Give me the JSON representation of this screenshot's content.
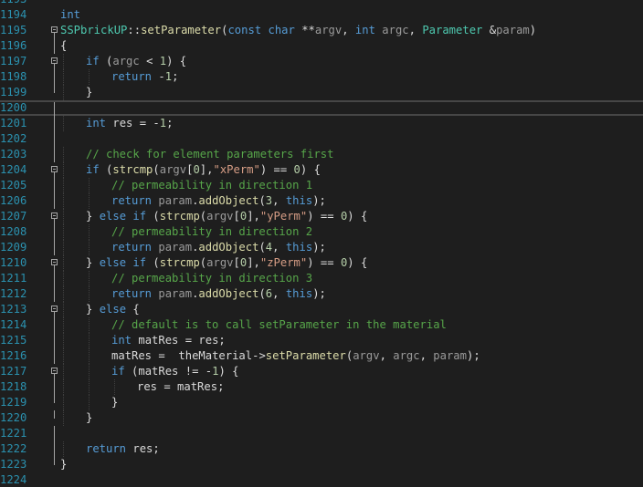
{
  "editor": {
    "lines": [
      {
        "n": "1194",
        "fold": "",
        "indent": 0,
        "tokens": [
          {
            "t": "int",
            "c": "kw"
          }
        ]
      },
      {
        "n": "1195",
        "fold": "start",
        "indent": 0,
        "tokens": [
          {
            "t": "SSPbrickUP",
            "c": "ty"
          },
          {
            "t": "::",
            "c": "pl"
          },
          {
            "t": "setParameter",
            "c": "fn"
          },
          {
            "t": "(",
            "c": "pl"
          },
          {
            "t": "const",
            "c": "kw"
          },
          {
            "t": " ",
            "c": "pl"
          },
          {
            "t": "char",
            "c": "kw"
          },
          {
            "t": " **",
            "c": "pl"
          },
          {
            "t": "argv",
            "c": "par"
          },
          {
            "t": ", ",
            "c": "pl"
          },
          {
            "t": "int",
            "c": "kw"
          },
          {
            "t": " ",
            "c": "pl"
          },
          {
            "t": "argc",
            "c": "par"
          },
          {
            "t": ", ",
            "c": "pl"
          },
          {
            "t": "Parameter",
            "c": "ty"
          },
          {
            "t": " &",
            "c": "pl"
          },
          {
            "t": "param",
            "c": "par"
          },
          {
            "t": ")",
            "c": "pl"
          }
        ]
      },
      {
        "n": "1196",
        "fold": "mid",
        "indent": 0,
        "tokens": [
          {
            "t": "{",
            "c": "pl"
          }
        ]
      },
      {
        "n": "1197",
        "fold": "start",
        "indent": 1,
        "tokens": [
          {
            "t": "if",
            "c": "kw"
          },
          {
            "t": " (",
            "c": "pl"
          },
          {
            "t": "argc",
            "c": "par"
          },
          {
            "t": " < ",
            "c": "pl"
          },
          {
            "t": "1",
            "c": "num"
          },
          {
            "t": ") {",
            "c": "pl"
          }
        ]
      },
      {
        "n": "1198",
        "fold": "mid",
        "indent": 2,
        "tokens": [
          {
            "t": "return",
            "c": "kw"
          },
          {
            "t": " -",
            "c": "pl"
          },
          {
            "t": "1",
            "c": "num"
          },
          {
            "t": ";",
            "c": "pl"
          }
        ]
      },
      {
        "n": "1199",
        "fold": "end",
        "indent": 1,
        "tokens": [
          {
            "t": "}",
            "c": "pl"
          }
        ]
      },
      {
        "n": "1200",
        "fold": "mid",
        "indent": 0,
        "current": true,
        "tokens": []
      },
      {
        "n": "1201",
        "fold": "mid",
        "indent": 1,
        "tokens": [
          {
            "t": "int",
            "c": "kw"
          },
          {
            "t": " ",
            "c": "pl"
          },
          {
            "t": "res",
            "c": "var"
          },
          {
            "t": " = -",
            "c": "pl"
          },
          {
            "t": "1",
            "c": "num"
          },
          {
            "t": ";",
            "c": "pl"
          }
        ]
      },
      {
        "n": "1202",
        "fold": "mid",
        "indent": 0,
        "tokens": []
      },
      {
        "n": "1203",
        "fold": "mid",
        "indent": 1,
        "tokens": [
          {
            "t": "// check for element parameters first",
            "c": "cm"
          }
        ]
      },
      {
        "n": "1204",
        "fold": "start",
        "indent": 1,
        "tokens": [
          {
            "t": "if",
            "c": "kw"
          },
          {
            "t": " (",
            "c": "pl"
          },
          {
            "t": "strcmp",
            "c": "fn"
          },
          {
            "t": "(",
            "c": "pl"
          },
          {
            "t": "argv",
            "c": "par"
          },
          {
            "t": "[",
            "c": "pl"
          },
          {
            "t": "0",
            "c": "num"
          },
          {
            "t": "],",
            "c": "pl"
          },
          {
            "t": "\"xPerm\"",
            "c": "str"
          },
          {
            "t": ") == ",
            "c": "pl"
          },
          {
            "t": "0",
            "c": "num"
          },
          {
            "t": ") {",
            "c": "pl"
          }
        ]
      },
      {
        "n": "1205",
        "fold": "mid",
        "indent": 2,
        "tokens": [
          {
            "t": "// permeability in direction 1",
            "c": "cm"
          }
        ]
      },
      {
        "n": "1206",
        "fold": "mid",
        "indent": 2,
        "tokens": [
          {
            "t": "return",
            "c": "kw"
          },
          {
            "t": " ",
            "c": "pl"
          },
          {
            "t": "param",
            "c": "par"
          },
          {
            "t": ".",
            "c": "pl"
          },
          {
            "t": "addObject",
            "c": "fn"
          },
          {
            "t": "(",
            "c": "pl"
          },
          {
            "t": "3",
            "c": "num"
          },
          {
            "t": ", ",
            "c": "pl"
          },
          {
            "t": "this",
            "c": "kw"
          },
          {
            "t": ");",
            "c": "pl"
          }
        ]
      },
      {
        "n": "1207",
        "fold": "start",
        "indent": 1,
        "tokens": [
          {
            "t": "} ",
            "c": "pl"
          },
          {
            "t": "else",
            "c": "kw"
          },
          {
            "t": " ",
            "c": "pl"
          },
          {
            "t": "if",
            "c": "kw"
          },
          {
            "t": " (",
            "c": "pl"
          },
          {
            "t": "strcmp",
            "c": "fn"
          },
          {
            "t": "(",
            "c": "pl"
          },
          {
            "t": "argv",
            "c": "par"
          },
          {
            "t": "[",
            "c": "pl"
          },
          {
            "t": "0",
            "c": "num"
          },
          {
            "t": "],",
            "c": "pl"
          },
          {
            "t": "\"yPerm\"",
            "c": "str"
          },
          {
            "t": ") == ",
            "c": "pl"
          },
          {
            "t": "0",
            "c": "num"
          },
          {
            "t": ") {",
            "c": "pl"
          }
        ]
      },
      {
        "n": "1208",
        "fold": "mid",
        "indent": 2,
        "tokens": [
          {
            "t": "// permeability in direction 2",
            "c": "cm"
          }
        ]
      },
      {
        "n": "1209",
        "fold": "mid",
        "indent": 2,
        "tokens": [
          {
            "t": "return",
            "c": "kw"
          },
          {
            "t": " ",
            "c": "pl"
          },
          {
            "t": "param",
            "c": "par"
          },
          {
            "t": ".",
            "c": "pl"
          },
          {
            "t": "addObject",
            "c": "fn"
          },
          {
            "t": "(",
            "c": "pl"
          },
          {
            "t": "4",
            "c": "num"
          },
          {
            "t": ", ",
            "c": "pl"
          },
          {
            "t": "this",
            "c": "kw"
          },
          {
            "t": ");",
            "c": "pl"
          }
        ]
      },
      {
        "n": "1210",
        "fold": "start",
        "indent": 1,
        "tokens": [
          {
            "t": "} ",
            "c": "pl"
          },
          {
            "t": "else",
            "c": "kw"
          },
          {
            "t": " ",
            "c": "pl"
          },
          {
            "t": "if",
            "c": "kw"
          },
          {
            "t": " (",
            "c": "pl"
          },
          {
            "t": "strcmp",
            "c": "fn"
          },
          {
            "t": "(",
            "c": "pl"
          },
          {
            "t": "argv",
            "c": "par"
          },
          {
            "t": "[",
            "c": "pl"
          },
          {
            "t": "0",
            "c": "num"
          },
          {
            "t": "],",
            "c": "pl"
          },
          {
            "t": "\"zPerm\"",
            "c": "str"
          },
          {
            "t": ") == ",
            "c": "pl"
          },
          {
            "t": "0",
            "c": "num"
          },
          {
            "t": ") {",
            "c": "pl"
          }
        ]
      },
      {
        "n": "1211",
        "fold": "mid",
        "indent": 2,
        "tokens": [
          {
            "t": "// permeability in direction 3",
            "c": "cm"
          }
        ]
      },
      {
        "n": "1212",
        "fold": "mid",
        "indent": 2,
        "tokens": [
          {
            "t": "return",
            "c": "kw"
          },
          {
            "t": " ",
            "c": "pl"
          },
          {
            "t": "param",
            "c": "par"
          },
          {
            "t": ".",
            "c": "pl"
          },
          {
            "t": "addObject",
            "c": "fn"
          },
          {
            "t": "(",
            "c": "pl"
          },
          {
            "t": "6",
            "c": "num"
          },
          {
            "t": ", ",
            "c": "pl"
          },
          {
            "t": "this",
            "c": "kw"
          },
          {
            "t": ");",
            "c": "pl"
          }
        ]
      },
      {
        "n": "1213",
        "fold": "start",
        "indent": 1,
        "tokens": [
          {
            "t": "} ",
            "c": "pl"
          },
          {
            "t": "else",
            "c": "kw"
          },
          {
            "t": " {",
            "c": "pl"
          }
        ]
      },
      {
        "n": "1214",
        "fold": "mid",
        "indent": 2,
        "tokens": [
          {
            "t": "// default is to call setParameter in the material",
            "c": "cm"
          }
        ]
      },
      {
        "n": "1215",
        "fold": "mid",
        "indent": 2,
        "tokens": [
          {
            "t": "int",
            "c": "kw"
          },
          {
            "t": " ",
            "c": "pl"
          },
          {
            "t": "matRes",
            "c": "var"
          },
          {
            "t": " = ",
            "c": "pl"
          },
          {
            "t": "res",
            "c": "var"
          },
          {
            "t": ";",
            "c": "pl"
          }
        ]
      },
      {
        "n": "1216",
        "fold": "mid",
        "indent": 2,
        "tokens": [
          {
            "t": "matRes",
            "c": "var"
          },
          {
            "t": " =  ",
            "c": "pl"
          },
          {
            "t": "theMaterial",
            "c": "var"
          },
          {
            "t": "->",
            "c": "pl"
          },
          {
            "t": "setParameter",
            "c": "fn"
          },
          {
            "t": "(",
            "c": "pl"
          },
          {
            "t": "argv",
            "c": "par"
          },
          {
            "t": ", ",
            "c": "pl"
          },
          {
            "t": "argc",
            "c": "par"
          },
          {
            "t": ", ",
            "c": "pl"
          },
          {
            "t": "param",
            "c": "par"
          },
          {
            "t": ");",
            "c": "pl"
          }
        ]
      },
      {
        "n": "1217",
        "fold": "start",
        "indent": 2,
        "tokens": [
          {
            "t": "if",
            "c": "kw"
          },
          {
            "t": " (",
            "c": "pl"
          },
          {
            "t": "matRes",
            "c": "var"
          },
          {
            "t": " != -",
            "c": "pl"
          },
          {
            "t": "1",
            "c": "num"
          },
          {
            "t": ") {",
            "c": "pl"
          }
        ]
      },
      {
        "n": "1218",
        "fold": "mid",
        "indent": 3,
        "tokens": [
          {
            "t": "res",
            "c": "var"
          },
          {
            "t": " = ",
            "c": "pl"
          },
          {
            "t": "matRes",
            "c": "var"
          },
          {
            "t": ";",
            "c": "pl"
          }
        ]
      },
      {
        "n": "1219",
        "fold": "end",
        "indent": 2,
        "tokens": [
          {
            "t": "}",
            "c": "pl"
          }
        ]
      },
      {
        "n": "1220",
        "fold": "end",
        "indent": 1,
        "tokens": [
          {
            "t": "}",
            "c": "pl"
          }
        ]
      },
      {
        "n": "1221",
        "fold": "mid",
        "indent": 0,
        "tokens": []
      },
      {
        "n": "1222",
        "fold": "mid",
        "indent": 1,
        "tokens": [
          {
            "t": "return",
            "c": "kw"
          },
          {
            "t": " ",
            "c": "pl"
          },
          {
            "t": "res",
            "c": "var"
          },
          {
            "t": ";",
            "c": "pl"
          }
        ]
      },
      {
        "n": "1223",
        "fold": "end",
        "indent": 0,
        "tokens": [
          {
            "t": "}",
            "c": "pl"
          }
        ]
      },
      {
        "n": "1224",
        "fold": "",
        "indent": 0,
        "tokens": []
      }
    ],
    "top_partial_line": "1193"
  },
  "colors": {
    "background": "#1e1e1e",
    "line_number": "#2b91af",
    "keyword": "#569cd6",
    "function": "#dcdcaa",
    "type": "#4ec9b0",
    "string": "#d69d85",
    "comment": "#57a64a",
    "number": "#b5cea8"
  }
}
